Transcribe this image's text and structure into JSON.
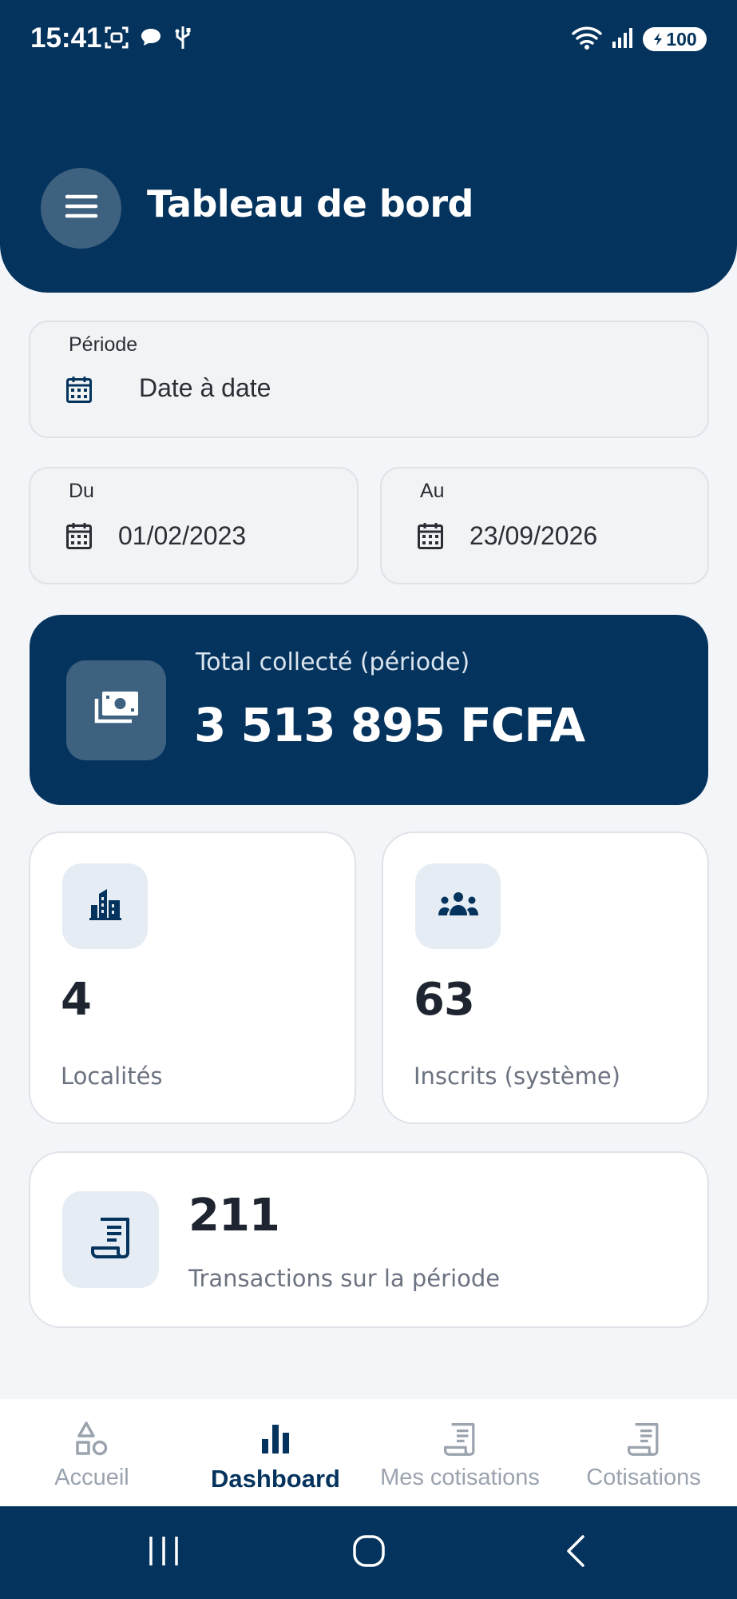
{
  "status_bar": {
    "time": "15:41",
    "battery": "100"
  },
  "header": {
    "title": "Tableau de bord",
    "menu_icon": "hamburger-menu-icon"
  },
  "filters": {
    "period": {
      "label": "Période",
      "value": "Date à date",
      "icon": "calendar-icon"
    },
    "from": {
      "label": "Du",
      "value": "01/02/2023",
      "icon": "calendar-icon"
    },
    "to": {
      "label": "Au",
      "value": "23/09/2026",
      "icon": "calendar-icon"
    }
  },
  "total": {
    "label": "Total collecté (période)",
    "value": "3 513 895 FCFA",
    "icon": "money-icon"
  },
  "stats": {
    "localities": {
      "value": "4",
      "label": "Localités",
      "icon": "buildings-icon"
    },
    "registered": {
      "value": "63",
      "label": "Inscrits (système)",
      "icon": "group-icon"
    },
    "transactions": {
      "value": "211",
      "label": "Transactions sur la période",
      "icon": "receipt-icon"
    }
  },
  "bottom_nav": {
    "items": [
      {
        "label": "Accueil",
        "icon": "shapes-icon",
        "active": false
      },
      {
        "label": "Dashboard",
        "icon": "bar-chart-icon",
        "active": true
      },
      {
        "label": "Mes cotisations",
        "icon": "receipt-icon",
        "active": false
      },
      {
        "label": "Cotisations",
        "icon": "receipt-icon",
        "active": false
      }
    ]
  },
  "colors": {
    "primary": "#04335d",
    "icon_box": "#3d617f",
    "icon_tint_bg": "#e5ecf3",
    "background": "#f3f5f8",
    "muted_text": "#6b7280",
    "inactive_nav": "#9aa3ae"
  }
}
